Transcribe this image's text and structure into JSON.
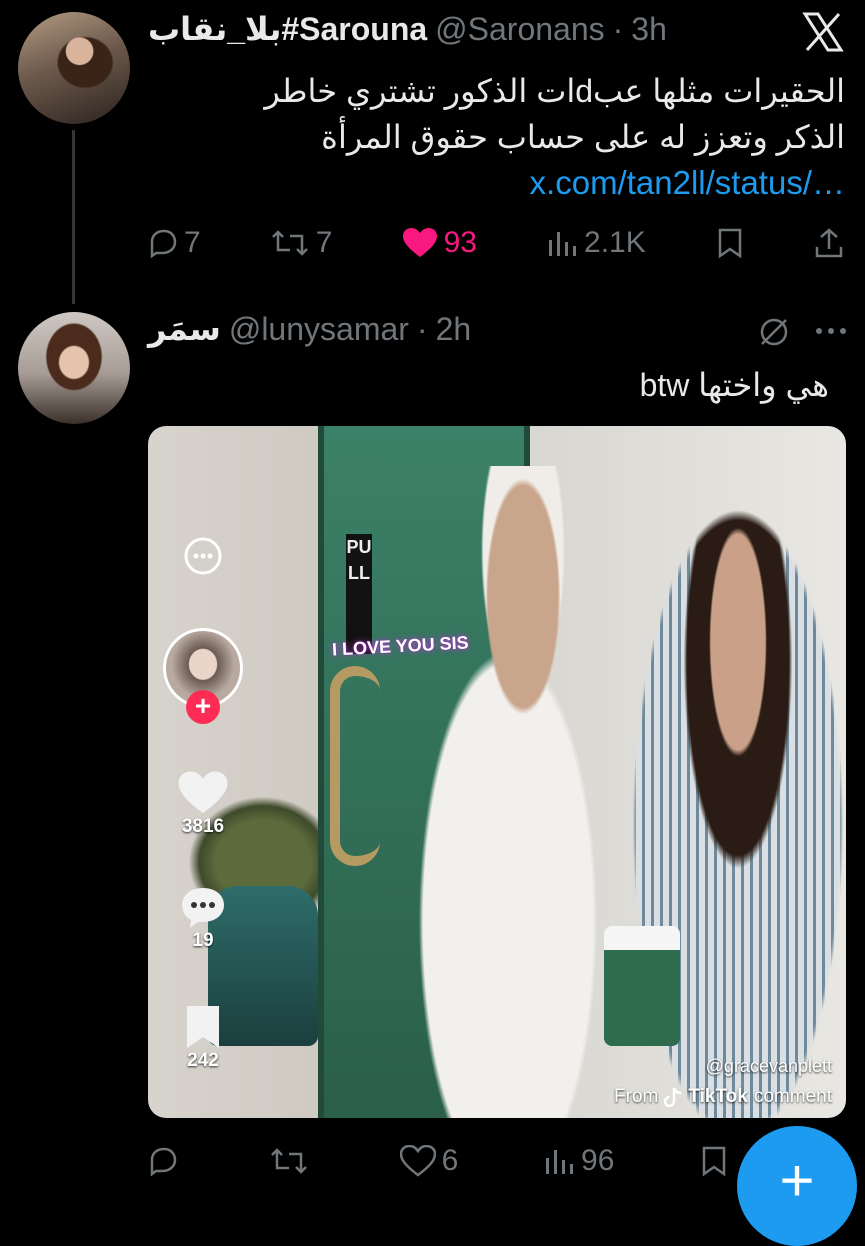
{
  "tweet1": {
    "display_name": "بلا_نقاب#Sarouna",
    "handle": "@Saronans",
    "time": "3h",
    "text_line1": "الحقيرات مثلها عبdات الذكور تشتري خاطر",
    "text_line2": "الذكر وتعزز له على حساب حقوق المرأة",
    "link": "x.com/tan2ll/status/…",
    "replies": "7",
    "reposts": "7",
    "likes": "93",
    "views": "2.1K",
    "like_color": "#f91880",
    "platform_icon": "x-logo-icon"
  },
  "tweet2": {
    "display_name": "سمَر",
    "handle": "@lunysamar",
    "time": "2h",
    "text": "هي واختها btw",
    "replies": "",
    "reposts": "",
    "likes": "6",
    "views": "96",
    "media": {
      "overlay_text": "I LOVE YOU SIS",
      "door_sign": "PULL",
      "tiktok_likes": "3816",
      "tiktok_comments": "19",
      "tiktok_saves": "242",
      "credit": "@gracevanplett",
      "from_prefix": "From",
      "from_brand": "TikTok",
      "from_suffix": "comment"
    }
  },
  "fab": {
    "label": "+"
  },
  "colors": {
    "background": "#000000",
    "text": "#e7e9ea",
    "muted": "#71767b",
    "link": "#1d9bf0"
  }
}
